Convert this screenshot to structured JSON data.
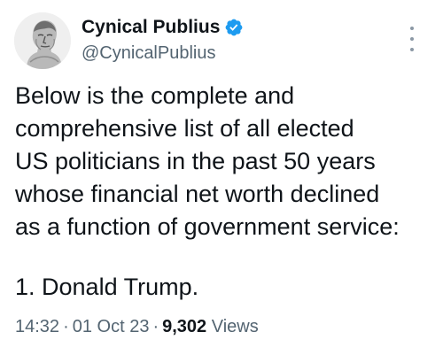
{
  "author": {
    "display_name": "Cynical Publius",
    "handle": "@CynicalPublius",
    "verified_badge_color": "#1d9bf0",
    "avatar_icon": "roman-bust-avatar"
  },
  "tweet": {
    "text_lines": [
      "Below is the complete and",
      "comprehensive list of all elected",
      "US politicians in the past 50 years",
      "whose financial net worth declined",
      "as a function of government service:"
    ],
    "list_item": "1. Donald Trump."
  },
  "meta": {
    "time": "14:32",
    "separator": "·",
    "date": "01 Oct 23",
    "views_count": "9,302",
    "views_label": "Views"
  },
  "menu": {
    "icon": "more-options-icon"
  }
}
